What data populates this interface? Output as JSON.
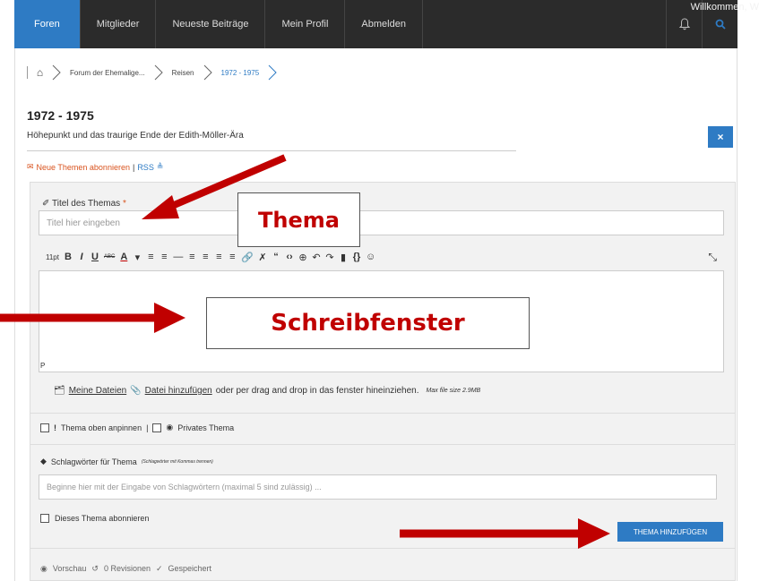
{
  "welcome_text": "Willkommen, W",
  "nav": {
    "items": [
      {
        "label": "Foren",
        "active": true
      },
      {
        "label": "Mitglieder",
        "active": false
      },
      {
        "label": "Neueste Beiträge",
        "active": false
      },
      {
        "label": "Mein Profil",
        "active": false
      },
      {
        "label": "Abmelden",
        "active": false
      }
    ]
  },
  "breadcrumb": {
    "items": [
      "Forum der Ehemalige...",
      "Reisen",
      "1972 - 1975"
    ]
  },
  "page": {
    "title": "1972 - 1975",
    "subtitle": "Höhepunkt und das traurige Ende der Edith-Möller-Ära",
    "close_label": "×"
  },
  "subscribe": {
    "link": "Neue Themen abonnieren",
    "separator": "|",
    "rss": "RSS"
  },
  "form": {
    "topic_label": "Titel des Themas",
    "required_mark": "*",
    "topic_placeholder": "Titel hier eingeben",
    "toolbar": {
      "font_size": "11pt",
      "bold": "B",
      "italic": "I",
      "underline": "U",
      "strike": "ABC",
      "color": "A"
    },
    "editor_path": "P",
    "files": {
      "my_files": "Meine Dateien",
      "add_file": "Datei hinzufügen",
      "drag_text": "oder per drag and drop in das fenster hineinziehen.",
      "max_size": "Max file size 2.9MB"
    },
    "pin_label": "Thema oben anpinnen",
    "private_label": "Privates Thema",
    "options_sep": "|",
    "tags_label": "Schlagwörter für Thema",
    "tags_hint": "(Schlagwörter mit Kommas trennen)",
    "tags_placeholder": "Beginne hier mit der Eingabe von Schlagwörtern (maximal 5 sind zulässig) ...",
    "subscribe_label": "Dieses Thema abonnieren",
    "submit_label": "THEMA HINZUFÜGEN"
  },
  "footer": {
    "preview": "Vorschau",
    "revisions": "0 Revisionen",
    "saved": "Gespeichert"
  },
  "annotations": {
    "thema": "Thema",
    "schreibfenster": "Schreibfenster",
    "arrow_color": "#c00000"
  }
}
